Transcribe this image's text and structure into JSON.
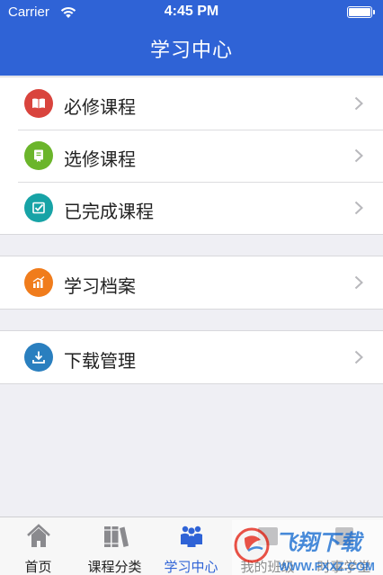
{
  "status": {
    "carrier": "Carrier",
    "time": "4:45 PM"
  },
  "header": {
    "title": "学习中心"
  },
  "colors": {
    "header_bg": "#2f63d6",
    "active_tab": "#2f63d6"
  },
  "groups": [
    {
      "items": [
        {
          "label": "必修课程",
          "icon": "book-icon",
          "icon_color": "#d9443d"
        },
        {
          "label": "选修课程",
          "icon": "document-icon",
          "icon_color": "#6bb52b"
        },
        {
          "label": "已完成课程",
          "icon": "checkbox-icon",
          "icon_color": "#17a3a6"
        }
      ]
    },
    {
      "items": [
        {
          "label": "学习档案",
          "icon": "bar-chart-icon",
          "icon_color": "#f07c1c"
        }
      ]
    },
    {
      "items": [
        {
          "label": "下载管理",
          "icon": "download-icon",
          "icon_color": "#2a7fbf"
        }
      ]
    }
  ],
  "tabs": [
    {
      "label": "首页",
      "icon": "home-icon",
      "active": false
    },
    {
      "label": "课程分类",
      "icon": "books-icon",
      "active": false
    },
    {
      "label": "学习中心",
      "icon": "people-icon",
      "active": true
    },
    {
      "label": "我的班级",
      "icon": "class-icon",
      "active": false
    },
    {
      "label": "时事学堂",
      "icon": "news-icon",
      "active": false
    }
  ],
  "watermark": {
    "text": "飞翔下载",
    "url": "WWW.FXXZ.COM"
  }
}
